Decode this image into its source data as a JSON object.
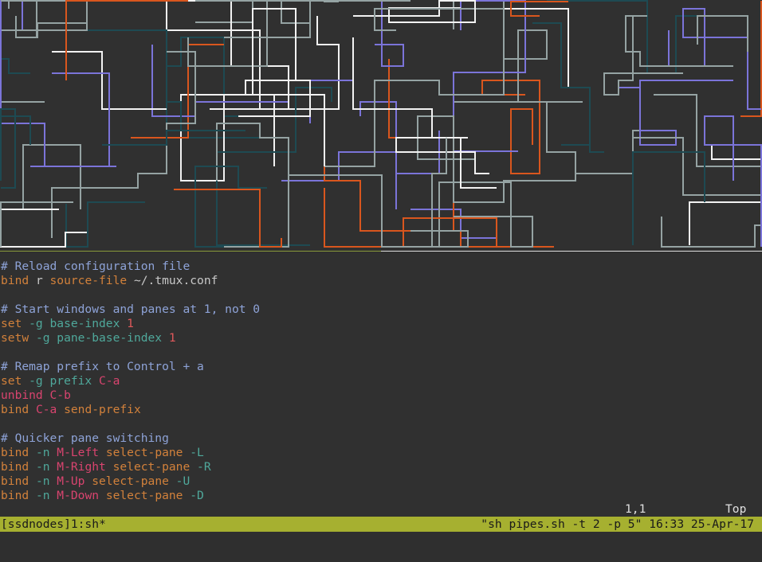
{
  "colors": {
    "background": "#2f2f2f",
    "status_bar": "#a6b030",
    "comment": "#8ea3d8",
    "keyword": "#d2813b",
    "flag": "#4fa89b",
    "key": "#d9446f",
    "number": "#e0595b",
    "pipe_white": "#f2f2f2",
    "pipe_grey": "#95a3a3",
    "pipe_blue": "#7b74d9",
    "pipe_orange": "#d9561e",
    "pipe_teal": "#1e4a52"
  },
  "editor": {
    "lines": [
      [
        {
          "t": "comment",
          "v": "# Reload configuration file"
        }
      ],
      [
        {
          "t": "kw",
          "v": "bind"
        },
        {
          "t": "arg",
          "v": " r "
        },
        {
          "t": "cmd",
          "v": "source-file"
        },
        {
          "t": "path",
          "v": " ~/.tmux.conf"
        }
      ],
      [],
      [
        {
          "t": "comment",
          "v": "# Start windows and panes at 1, not 0"
        }
      ],
      [
        {
          "t": "kw",
          "v": "set"
        },
        {
          "t": "flag",
          "v": " -g"
        },
        {
          "t": "flag",
          "v": " base-index"
        },
        {
          "t": "num",
          "v": " 1"
        }
      ],
      [
        {
          "t": "kw",
          "v": "setw"
        },
        {
          "t": "flag",
          "v": " -g"
        },
        {
          "t": "flag",
          "v": " pane-base-index"
        },
        {
          "t": "num",
          "v": " 1"
        }
      ],
      [],
      [
        {
          "t": "comment",
          "v": "# Remap prefix to Control + a"
        }
      ],
      [
        {
          "t": "kw",
          "v": "set"
        },
        {
          "t": "flag",
          "v": " -g"
        },
        {
          "t": "flag",
          "v": " prefix"
        },
        {
          "t": "key",
          "v": " C-a"
        }
      ],
      [
        {
          "t": "key",
          "v": "unbind"
        },
        {
          "t": "key",
          "v": " C-b"
        }
      ],
      [
        {
          "t": "kw",
          "v": "bind"
        },
        {
          "t": "key",
          "v": " C-a"
        },
        {
          "t": "cmd",
          "v": " send-prefix"
        }
      ],
      [],
      [
        {
          "t": "comment",
          "v": "# Quicker pane switching"
        }
      ],
      [
        {
          "t": "kw",
          "v": "bind"
        },
        {
          "t": "flag",
          "v": " -n"
        },
        {
          "t": "key",
          "v": " M-Left"
        },
        {
          "t": "cmd",
          "v": " select-pane"
        },
        {
          "t": "flag",
          "v": " -L"
        }
      ],
      [
        {
          "t": "kw",
          "v": "bind"
        },
        {
          "t": "flag",
          "v": " -n"
        },
        {
          "t": "key",
          "v": " M-Right"
        },
        {
          "t": "cmd",
          "v": " select-pane"
        },
        {
          "t": "flag",
          "v": " -R"
        }
      ],
      [
        {
          "t": "kw",
          "v": "bind"
        },
        {
          "t": "flag",
          "v": " -n"
        },
        {
          "t": "key",
          "v": " M-Up"
        },
        {
          "t": "cmd",
          "v": " select-pane"
        },
        {
          "t": "flag",
          "v": " -U"
        }
      ],
      [
        {
          "t": "kw",
          "v": "bind"
        },
        {
          "t": "flag",
          "v": " -n"
        },
        {
          "t": "key",
          "v": " M-Down"
        },
        {
          "t": "cmd",
          "v": " select-pane"
        },
        {
          "t": "flag",
          "v": " -D"
        }
      ]
    ],
    "cursor_position": "1,1",
    "scroll_position": "Top"
  },
  "status_bar": {
    "session_window": "[ssdnodes]1:sh*",
    "pane_title": "\"sh pipes.sh -t 2 -p 5\"",
    "time": "16:33",
    "date": "25-Apr-17"
  }
}
